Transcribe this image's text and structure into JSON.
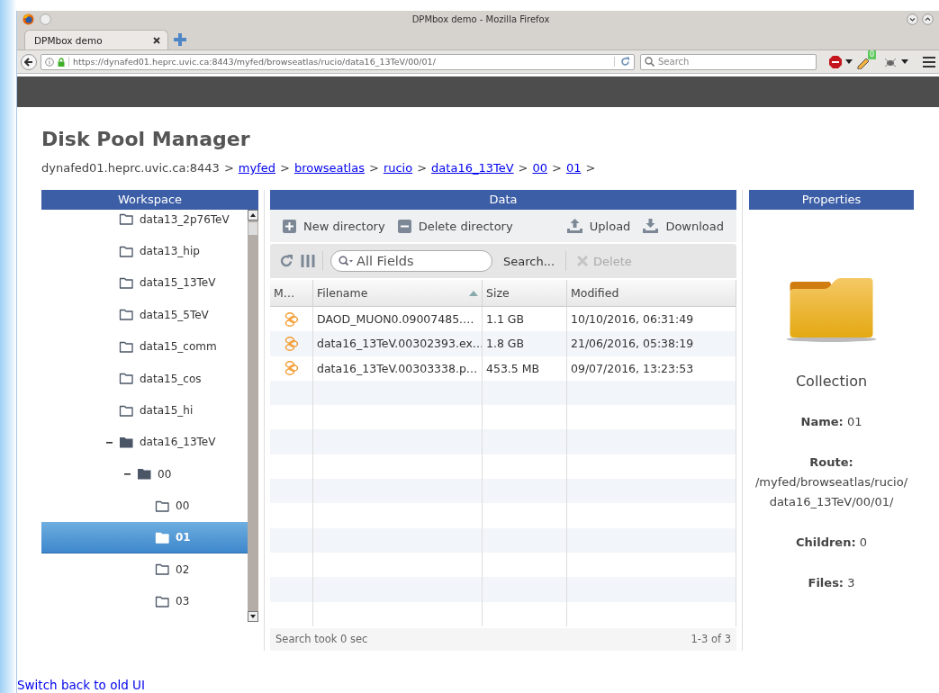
{
  "window": {
    "title": "DPMbox demo - Mozilla Firefox"
  },
  "tabs": [
    {
      "label": "DPMbox demo",
      "selected": true
    }
  ],
  "address_bar": {
    "url": "https://dynafed01.heprc.uvic.ca:8443/myfed/browseatlas/rucio/data16_13TeV/00/01/"
  },
  "search_bar": {
    "placeholder": "Search"
  },
  "extension_badge": "0",
  "page": {
    "title": "Disk Pool Manager",
    "breadcrumb": [
      {
        "label": "dynafed01.heprc.uvic.ca:8443",
        "link": false,
        "separator": ">"
      },
      {
        "label": "myfed",
        "link": true,
        "separator": ">"
      },
      {
        "label": "browseatlas",
        "link": true,
        "separator": ">"
      },
      {
        "label": "rucio",
        "link": true,
        "separator": ">"
      },
      {
        "label": "data16_13TeV",
        "link": true,
        "separator": ">"
      },
      {
        "label": "00",
        "link": true,
        "separator": ">"
      },
      {
        "label": "01",
        "link": true,
        "separator": ">"
      }
    ],
    "footer_link": "Switch back to old UI"
  },
  "workspace": {
    "title": "Workspace",
    "tree": [
      {
        "label": "data13_2p76TeV",
        "expanded": false,
        "selected": false
      },
      {
        "label": "data13_hip",
        "expanded": false,
        "selected": false
      },
      {
        "label": "data15_13TeV",
        "expanded": false,
        "selected": false
      },
      {
        "label": "data15_5TeV",
        "expanded": false,
        "selected": false
      },
      {
        "label": "data15_comm",
        "expanded": false,
        "selected": false
      },
      {
        "label": "data15_cos",
        "expanded": false,
        "selected": false
      },
      {
        "label": "data15_hi",
        "expanded": false,
        "selected": false
      },
      {
        "label": "data16_13TeV",
        "expanded": true,
        "selected": false,
        "children": [
          {
            "label": "00",
            "expanded": true,
            "selected": false,
            "children": [
              {
                "label": "00",
                "expanded": false,
                "selected": false
              },
              {
                "label": "01",
                "expanded": false,
                "selected": true
              },
              {
                "label": "02",
                "expanded": false,
                "selected": false
              },
              {
                "label": "03",
                "expanded": false,
                "selected": false
              }
            ]
          }
        ]
      }
    ]
  },
  "data": {
    "title": "Data",
    "actions": [
      {
        "label": "New directory",
        "kind": "new"
      },
      {
        "label": "Delete directory",
        "kind": "remove"
      },
      {
        "label": "Upload",
        "kind": "upload"
      },
      {
        "label": "Download",
        "kind": "download"
      }
    ],
    "search": {
      "placeholder": "All Fields"
    },
    "search_button": "Search...",
    "delete_button": {
      "label": "Delete",
      "disabled": true
    },
    "table": {
      "columns": [
        {
          "label": "M…",
          "sorted": false
        },
        {
          "label": "Filename",
          "sorted": true
        },
        {
          "label": "Size",
          "sorted": false
        },
        {
          "label": "Modified",
          "sorted": false
        }
      ],
      "rows": [
        {
          "cells": [
            "",
            "DAOD_MUON0.09007485.…",
            "1.1 GB",
            "10/10/2016, 06:31:49"
          ]
        },
        {
          "cells": [
            "",
            "data16_13TeV.00302393.ex…",
            "1.8 GB",
            "21/06/2016, 05:38:19"
          ]
        },
        {
          "cells": [
            "",
            "data16_13TeV.00303338.p…",
            "453.5 MB",
            "09/07/2016, 13:23:53"
          ]
        }
      ]
    },
    "status": "Search took 0 sec",
    "count": "1-3 of 3"
  },
  "properties": {
    "title": "Properties",
    "kind_label": "Collection",
    "fields": [
      "**Name:** 01",
      "**Route:** /myfed/browseatlas/rucio/data16_13TeV/00/01/",
      "**Children:** 0",
      "**Files:** 3"
    ]
  }
}
